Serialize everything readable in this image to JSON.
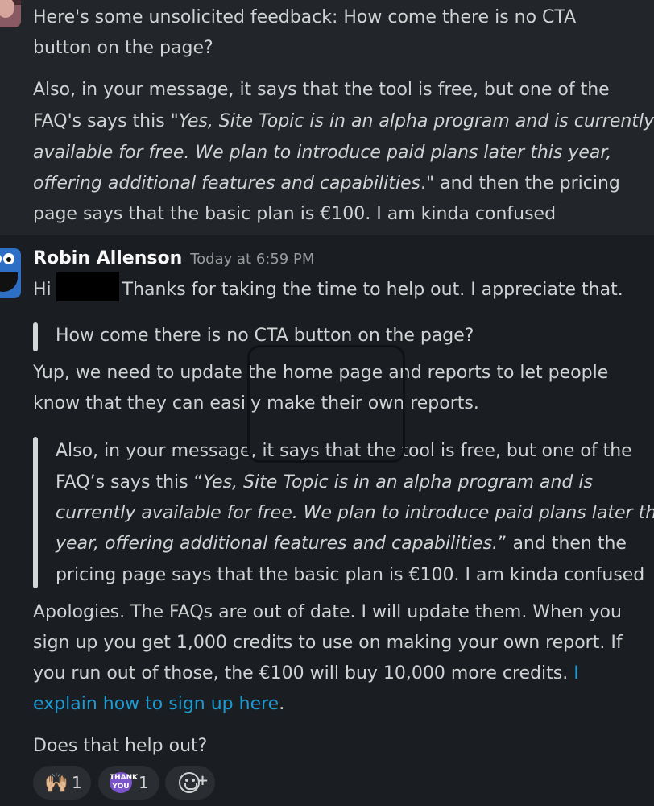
{
  "message1": {
    "paragraph1": [
      "Here's some unsolicited feedback: How come there is no CTA",
      "button on the page?"
    ],
    "paragraph2": {
      "line1": "Also, in your message, it says that the tool is free, but one of the",
      "line2_plain": "FAQ's says this \"",
      "line2_italic": "Yes, Site Topic is in an alpha program and is currently",
      "line3_italic": "available for free. We plan to introduce paid plans later this year,",
      "line4_italic": "offering additional features and capabilities",
      "line4_plain": ".\" and then the pricing",
      "line5": "page says that the basic plan is €100. I am kinda confused"
    }
  },
  "message2": {
    "sender": "Robin Allenson",
    "timestamp": "Today at 6:59 PM",
    "greeting_start": "Hi",
    "greeting_rest": "Thanks for taking the time to help out. I appreciate that.",
    "quote1": "How come there is no CTA button on the page?",
    "reply1": [
      "Yup, we need to update the home page and reports to let people",
      "know that they can easily make their own reports."
    ],
    "quote2": {
      "line1": "Also, in your message, it says that the tool is free, but one of the",
      "line2_plain": "FAQ’s says this “",
      "line2_italic": "Yes, Site Topic is in an alpha program and is",
      "line3_italic": "currently available for free. We plan to introduce paid plans later this",
      "line4_italic": "year, offering additional features and capabilities.",
      "line4_plain": "” and then the",
      "line5": "pricing page says that the basic plan is €100. I am kinda confused"
    },
    "reply2": {
      "line1": "Apologies. The FAQs are out of date. I will update them. When you",
      "line2": "sign up you get 1,000 credits to use on making your own report. If",
      "line3_plain": "you run out of those, the €100 will buy 10,000 more credits.",
      "line3_link": "I",
      "line4_link": "explain how to sign up here",
      "line4_plain": "."
    },
    "closing": "Does that help out?"
  },
  "reactions": [
    {
      "emoji": "raised-hands",
      "glyph": "🙌🏼",
      "count": "1"
    },
    {
      "emoji": "thank-you",
      "glyph": "THANK YOU",
      "count": "1"
    }
  ],
  "add_reaction_icon": "add-reaction-icon",
  "colors": {
    "background": "#1a1d21",
    "highlight": "#222529",
    "link": "#1d9bd1"
  }
}
